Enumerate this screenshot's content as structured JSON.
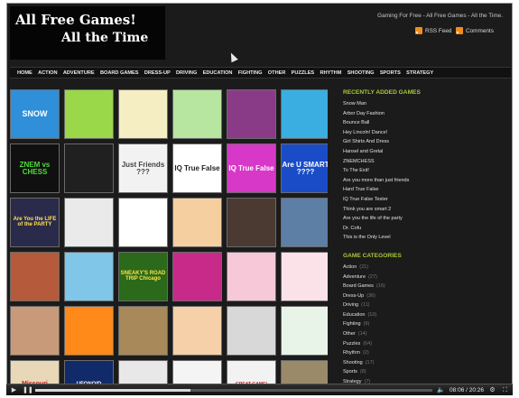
{
  "header": {
    "logo_line1": "All Free Games!",
    "logo_line2": "All the Time",
    "tagline": "Gaming For Free - All Free Games - All the Time.",
    "rss_label": "RSS Feed",
    "comments_label": "Comments"
  },
  "nav": [
    "HOME",
    "ACTION",
    "ADVENTURE",
    "BOARD GAMES",
    "DRESS-UP",
    "DRIVING",
    "EDUCATION",
    "FIGHTING",
    "OTHER",
    "PUZZLES",
    "RHYTHM",
    "SHOOTING",
    "SPORTS",
    "STRATEGY"
  ],
  "thumbs": [
    {
      "text": "SNOW",
      "bg": "#2f8fd8",
      "fg": "#ffffff",
      "fs": 9
    },
    {
      "text": "",
      "bg": "#9ad84a",
      "fg": "#000000",
      "fs": 8
    },
    {
      "text": "",
      "bg": "#f4eec2",
      "fg": "#000000",
      "fs": 8
    },
    {
      "text": "",
      "bg": "#b6e6a0",
      "fg": "#000000",
      "fs": 8
    },
    {
      "text": "",
      "bg": "#8a3b88",
      "fg": "#000000",
      "fs": 8
    },
    {
      "text": "",
      "bg": "#3aaee0",
      "fg": "#000000",
      "fs": 8
    },
    {
      "text": "ZNEM vs CHESS",
      "bg": "#101010",
      "fg": "#4fdc3a",
      "fs": 8
    },
    {
      "text": "",
      "bg": "#202020",
      "fg": "#ffffff",
      "fs": 8
    },
    {
      "text": "Just Friends ???",
      "bg": "#f2f2f2",
      "fg": "#444444",
      "fs": 8
    },
    {
      "text": "IQ True False",
      "bg": "#ffffff",
      "fg": "#222222",
      "fs": 8
    },
    {
      "text": "IQ True False",
      "bg": "#d838c8",
      "fg": "#ffffff",
      "fs": 8
    },
    {
      "text": "Are U SMART ????",
      "bg": "#1a4cc8",
      "fg": "#ffffff",
      "fs": 8
    },
    {
      "text": "Are You the LIFE of the PARTY",
      "bg": "#2a2a4a",
      "fg": "#ffe14a",
      "fs": 6
    },
    {
      "text": "",
      "bg": "#eaeaea",
      "fg": "#000000",
      "fs": 8
    },
    {
      "text": "",
      "bg": "#ffffff",
      "fg": "#000000",
      "fs": 8
    },
    {
      "text": "",
      "bg": "#f6cfa0",
      "fg": "#000000",
      "fs": 8
    },
    {
      "text": "",
      "bg": "#4a3a32",
      "fg": "#000000",
      "fs": 8
    },
    {
      "text": "",
      "bg": "#5d7fa6",
      "fg": "#000000",
      "fs": 8
    },
    {
      "text": "",
      "bg": "#b55a3a",
      "fg": "#000000",
      "fs": 8
    },
    {
      "text": "",
      "bg": "#7fc6e8",
      "fg": "#000000",
      "fs": 8
    },
    {
      "text": "SNEAKY'S ROAD TRIP Chicago",
      "bg": "#2a6a1a",
      "fg": "#ffe24a",
      "fs": 6
    },
    {
      "text": "",
      "bg": "#c82a8a",
      "fg": "#000000",
      "fs": 8
    },
    {
      "text": "",
      "bg": "#f6c8d8",
      "fg": "#000000",
      "fs": 8
    },
    {
      "text": "",
      "bg": "#fbe2e8",
      "fg": "#000000",
      "fs": 8
    },
    {
      "text": "",
      "bg": "#c89a7a",
      "fg": "#000000",
      "fs": 8
    },
    {
      "text": "",
      "bg": "#ff8a1a",
      "fg": "#000000",
      "fs": 8
    },
    {
      "text": "",
      "bg": "#a88a5a",
      "fg": "#000000",
      "fs": 8
    },
    {
      "text": "",
      "bg": "#f6d0a8",
      "fg": "#000000",
      "fs": 8
    },
    {
      "text": "",
      "bg": "#d8d8d8",
      "fg": "#000000",
      "fs": 8
    },
    {
      "text": "",
      "bg": "#e8f4e8",
      "fg": "#000000",
      "fs": 8
    },
    {
      "text": "Missouri",
      "bg": "#e8d8b8",
      "fg": "#b82020",
      "fs": 7
    },
    {
      "text": "UFONOID",
      "bg": "#102a6a",
      "fg": "#ffffff",
      "fs": 6
    },
    {
      "text": "",
      "bg": "#e8e8e8",
      "fg": "#000000",
      "fs": 8
    },
    {
      "text": "",
      "bg": "#f4f4f4",
      "fg": "#000000",
      "fs": 8
    },
    {
      "text": "GREAT GAME!",
      "bg": "#f2f2f2",
      "fg": "#b82020",
      "fs": 5
    },
    {
      "text": "",
      "bg": "#9a8a6a",
      "fg": "#000000",
      "fs": 8
    }
  ],
  "sidebar": {
    "recent_title": "RECENTLY ADDED GAMES",
    "recent": [
      "Snow Man",
      "Arbor Day Fashion",
      "Bounce Ball",
      "Hey Lincoln! Dance!",
      "Girl Shirts And Dress",
      "Hansel and Gretal",
      "ZNEMCHESS",
      "To The Exit!",
      "Are you more than just friends",
      "Hard True False",
      "IQ True False Tester",
      "Think you are smart 2",
      "Are you the life of the party",
      "Dr. Cofu",
      "This is the Only Level"
    ],
    "cats_title": "GAME CATEGORIES",
    "categories": [
      {
        "name": "Action",
        "count": "(21)"
      },
      {
        "name": "Adventure",
        "count": "(27)"
      },
      {
        "name": "Board Games",
        "count": "(16)"
      },
      {
        "name": "Dress-Up",
        "count": "(36)"
      },
      {
        "name": "Driving",
        "count": "(11)"
      },
      {
        "name": "Education",
        "count": "(10)"
      },
      {
        "name": "Fighting",
        "count": "(9)"
      },
      {
        "name": "Other",
        "count": "(14)"
      },
      {
        "name": "Puzzles",
        "count": "(64)"
      },
      {
        "name": "Rhythm",
        "count": "(2)"
      },
      {
        "name": "Shooting",
        "count": "(17)"
      },
      {
        "name": "Sports",
        "count": "(8)"
      },
      {
        "name": "Strategy",
        "count": "(7)"
      }
    ]
  },
  "player": {
    "time": "08:06 / 20:26",
    "progress": 0.39,
    "icons": [
      "play-icon",
      "pause-icon",
      "volume-icon",
      "fullscreen-icon",
      "settings-icon"
    ]
  }
}
